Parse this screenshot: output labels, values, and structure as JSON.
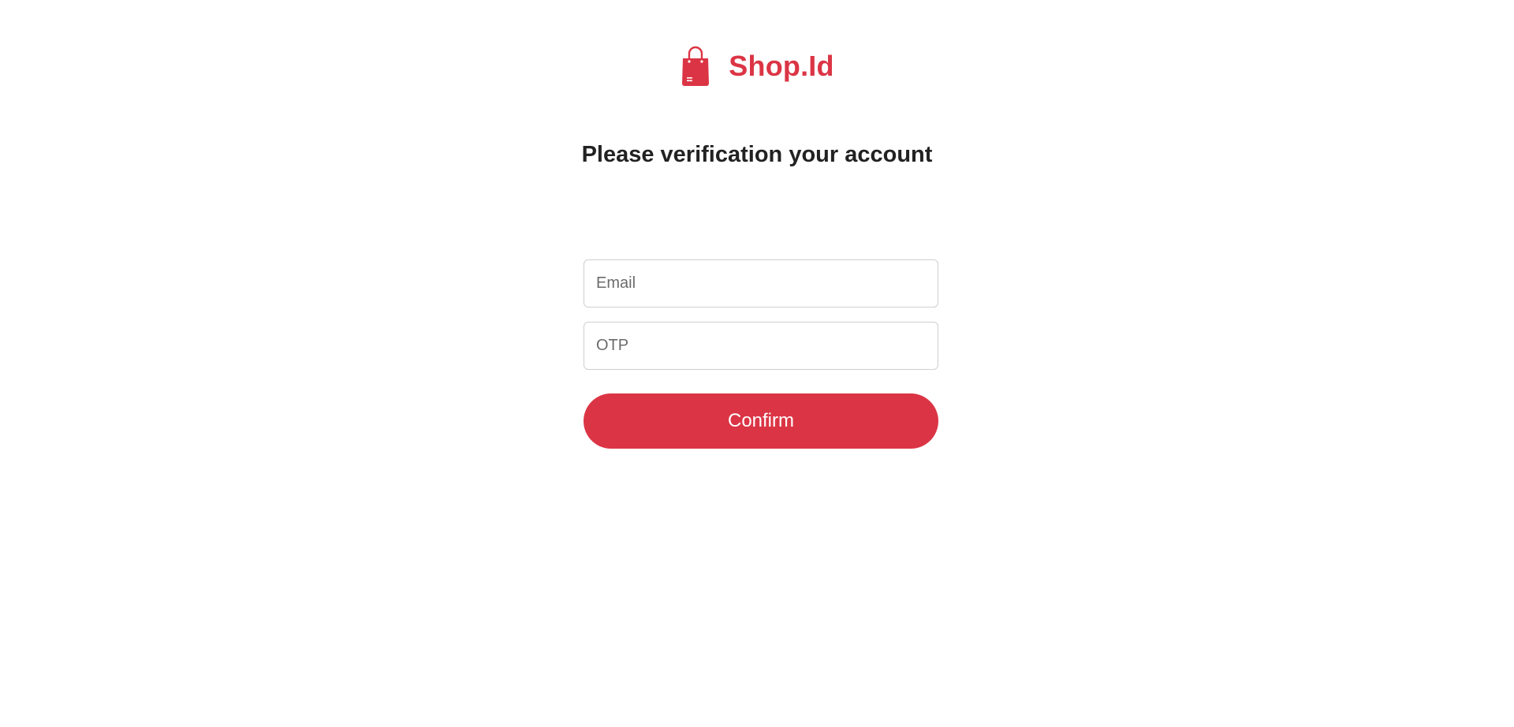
{
  "brand": {
    "name": "Shop.Id",
    "logo_icon": "shopping-bag-icon",
    "color": "#db3545"
  },
  "title": "Please verification your account",
  "form": {
    "email": {
      "value": "",
      "placeholder": "Email"
    },
    "otp": {
      "value": "",
      "placeholder": "OTP"
    },
    "confirm_label": "Confirm",
    "button_color": "#db3545"
  }
}
